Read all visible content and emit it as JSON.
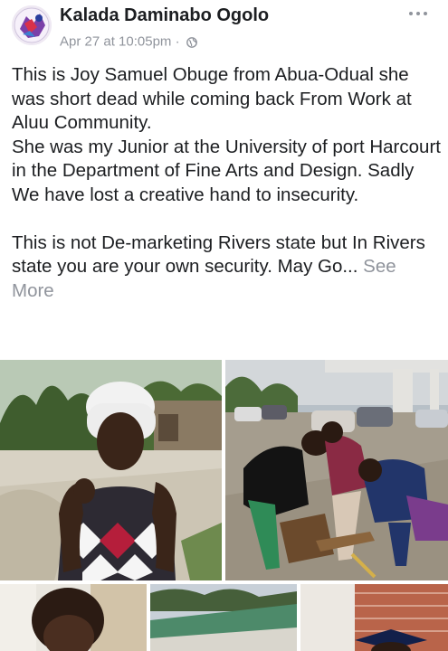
{
  "post": {
    "author": "Kalada Daminabo Ogolo",
    "timestamp": "Apr 27 at 10:05pm",
    "separator": "·",
    "privacy_icon": "globe-icon",
    "more_icon": "more-options-icon",
    "paragraphs": [
      "This is Joy Samuel Obuge from Abua-Odual she was short dead while coming back From Work at Aluu Community.",
      "She was my Junior at the University of port Harcourt in the Department of Fine Arts and Design. Sadly  We have lost a creative hand to insecurity."
    ],
    "last_paragraph": "This is not De-marketing Rivers state but In Rivers state you are your own security. May Go...",
    "see_more": "See More"
  },
  "colors": {
    "text": "#1c1e21",
    "secondary": "#90949c",
    "background": "#ffffff"
  }
}
